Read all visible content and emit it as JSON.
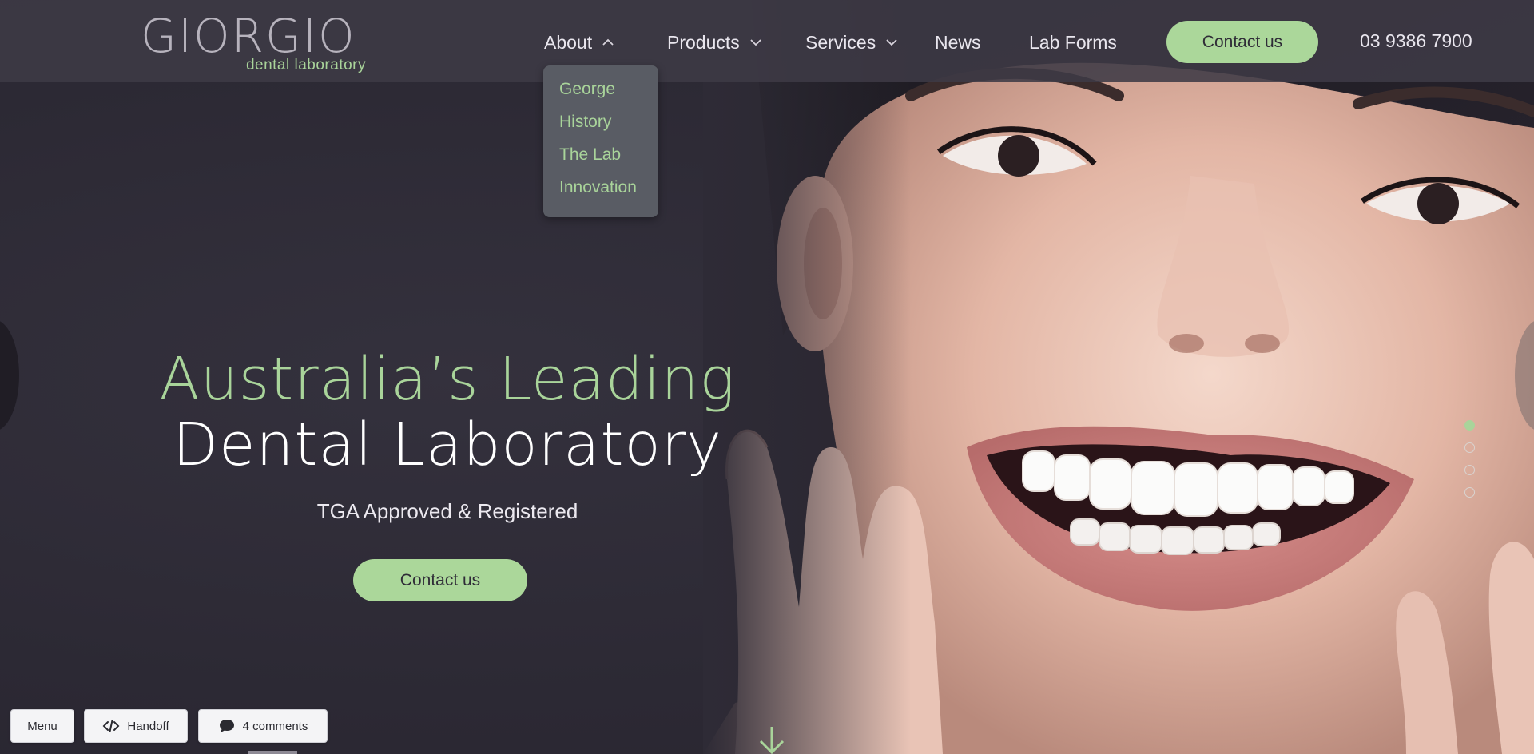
{
  "logo": {
    "wordmark": "GIORGIO",
    "tagline": "dental laboratory"
  },
  "nav": {
    "items": [
      {
        "label": "About",
        "has_dropdown": true,
        "expanded": true
      },
      {
        "label": "Products",
        "has_dropdown": true,
        "expanded": false
      },
      {
        "label": "Services",
        "has_dropdown": true,
        "expanded": false
      },
      {
        "label": "News",
        "has_dropdown": false
      },
      {
        "label": "Lab Forms",
        "has_dropdown": false
      }
    ],
    "contact_label": "Contact us",
    "phone": "03 9386 7900"
  },
  "about_dropdown": {
    "items": [
      "George",
      "History",
      "The Lab",
      "Innovation"
    ]
  },
  "hero": {
    "title_line1": "Australia’s Leading",
    "title_line2": "Dental Laboratory",
    "subtitle": "TGA Approved & Registered",
    "cta_label": "Contact us"
  },
  "carousel": {
    "slide_count": 4,
    "active_index": 0
  },
  "toolbar": {
    "menu_label": "Menu",
    "handoff_label": "Handoff",
    "comments_label": "4 comments"
  },
  "colors": {
    "accent_green": "#abd79a",
    "background": "#2e2b36",
    "header_bg": "#3e3a46",
    "dropdown_bg": "#595c64",
    "text_light": "#e9e6ee"
  },
  "icons": {
    "nav_chevron_up": "chevron-up-icon",
    "nav_chevron_down": "chevron-down-icon",
    "scroll": "arrow-down-icon",
    "handoff": "code-icon",
    "comments": "speech-bubble-icon"
  }
}
